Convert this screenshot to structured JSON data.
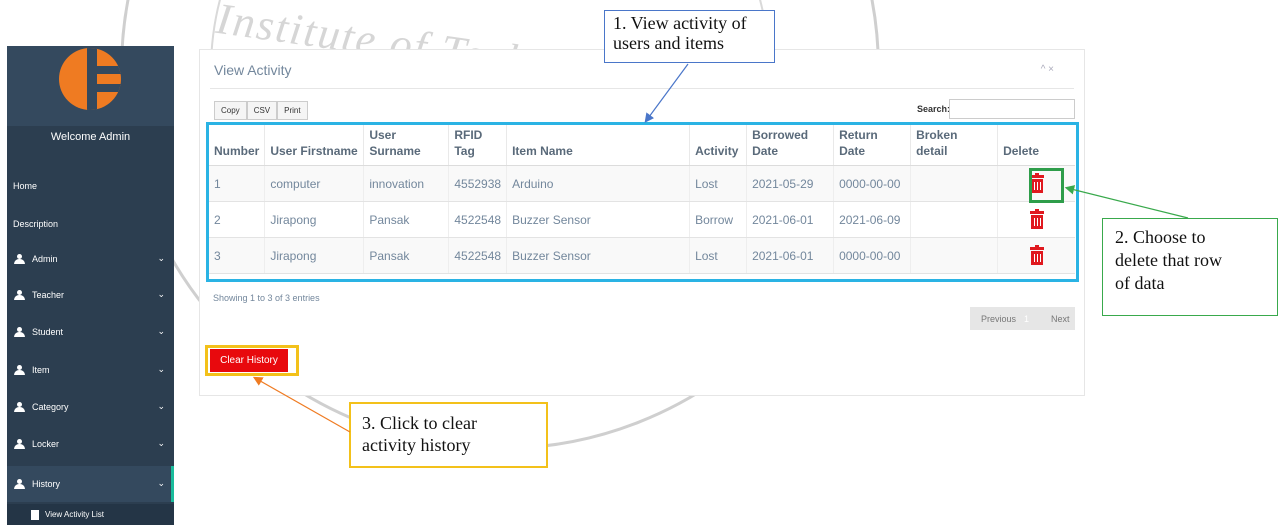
{
  "watermark_text": "Institute of Techno",
  "sidebar": {
    "welcome": "Welcome Admin",
    "items": [
      {
        "label": "Home",
        "icon": "none",
        "expandable": false
      },
      {
        "label": "Description",
        "icon": "none",
        "expandable": false
      },
      {
        "label": "Admin",
        "icon": "user-icon",
        "expandable": true
      },
      {
        "label": "Teacher",
        "icon": "user-icon",
        "expandable": true
      },
      {
        "label": "Student",
        "icon": "user-icon",
        "expandable": true
      },
      {
        "label": "Item",
        "icon": "user-icon",
        "expandable": true
      },
      {
        "label": "Category",
        "icon": "user-icon",
        "expandable": true
      },
      {
        "label": "Locker",
        "icon": "user-icon",
        "expandable": true
      },
      {
        "label": "History",
        "icon": "user-icon",
        "expandable": true
      }
    ],
    "sub_item": "View Activity List",
    "chevron": "⌄"
  },
  "panel": {
    "title": "View Activity",
    "tools": "^ ×",
    "buttons": [
      "Copy",
      "CSV",
      "Print"
    ],
    "search_label": "Search:",
    "search_value": ""
  },
  "table": {
    "headers": [
      "Number",
      "User Firstname",
      "User Surname",
      "RFID Tag",
      "Item Name",
      "Activity",
      "Borrowed Date",
      "Return Date",
      "Broken detail",
      "Delete"
    ],
    "rows": [
      [
        "1",
        "computer",
        "innovation",
        "4552938",
        "Arduino",
        "Lost",
        "2021-05-29",
        "0000-00-00",
        ""
      ],
      [
        "2",
        "Jirapong",
        "Pansak",
        "4522548",
        "Buzzer Sensor",
        "Borrow",
        "2021-06-01",
        "2021-06-09",
        ""
      ],
      [
        "3",
        "Jirapong",
        "Pansak",
        "4522548",
        "Buzzer Sensor",
        "Lost",
        "2021-06-01",
        "0000-00-00",
        ""
      ]
    ],
    "delete_icon": "trash-icon"
  },
  "showing_text": "Showing 1 to 3 of 3 entries",
  "pager": {
    "previous": "Previous",
    "current": "1",
    "next": "Next"
  },
  "clear_button": "Clear History",
  "callouts": {
    "c1_line1": "1. View activity of",
    "c1_line2": "users and items",
    "c2_line1": "2. Choose to",
    "c2_line2": "delete that row",
    "c2_line3": "of data",
    "c3_line1": "3. Click to clear",
    "c3_line2": "activity history"
  },
  "colors": {
    "sidebar": "#2c3e50",
    "accent_blue": "#2ab3e4",
    "accent_green": "#2e9d4a",
    "accent_yellow": "#f3c11a",
    "danger": "#e8090d",
    "logo_orange": "#ef7b22"
  }
}
